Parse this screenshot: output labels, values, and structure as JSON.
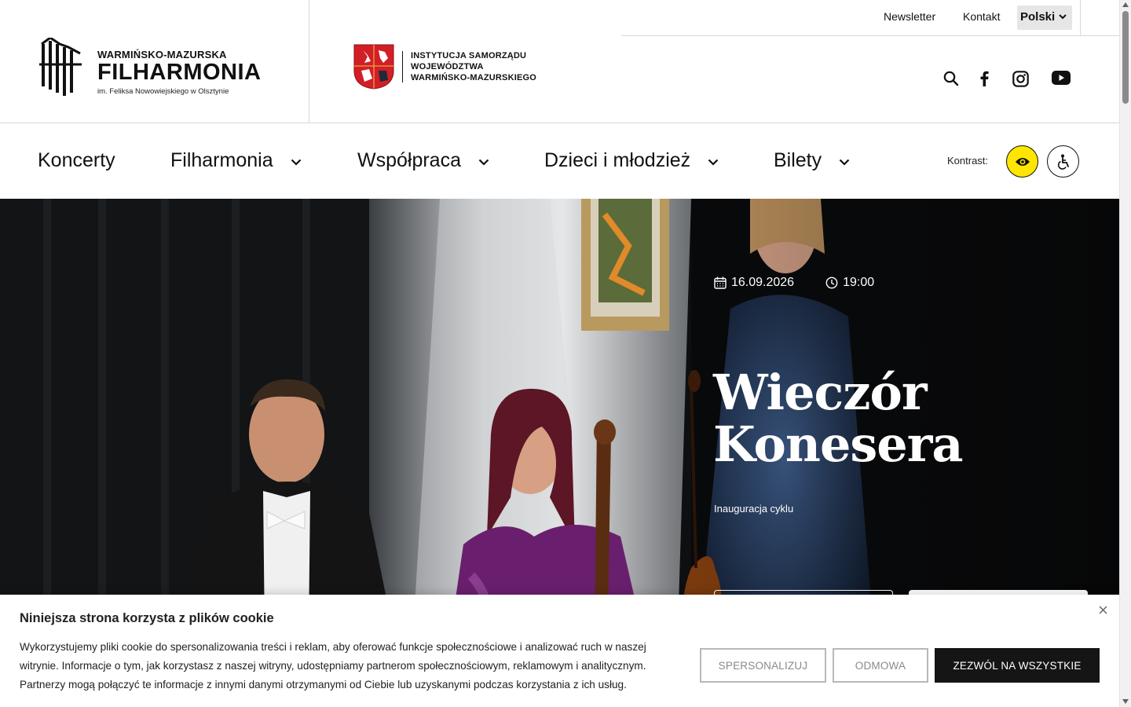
{
  "logo": {
    "line1": "WARMIŃSKO-MAZURSKA",
    "line2": "FILHARMONIA",
    "line3": "im. Feliksa Nowowiejskiego w Olsztynie"
  },
  "institution": {
    "lines": [
      "INSTYTUCJA SAMORZĄDU",
      "WOJEWÓDZTWA",
      "WARMIŃSKO-MAZURSKIEGO"
    ]
  },
  "topbar": {
    "newsletter": "Newsletter",
    "contact": "Kontakt",
    "language": "Polski"
  },
  "social_icons": [
    "search-icon",
    "facebook-icon",
    "instagram-icon",
    "youtube-icon"
  ],
  "nav": {
    "items": [
      {
        "label": "Koncerty",
        "dropdown": false
      },
      {
        "label": "Filharmonia",
        "dropdown": true
      },
      {
        "label": "Współpraca",
        "dropdown": true
      },
      {
        "label": "Dzieci i młodzież",
        "dropdown": true
      },
      {
        "label": "Bilety",
        "dropdown": true
      }
    ],
    "contrast_label": "Kontrast:"
  },
  "hero": {
    "date": "16.09.2026",
    "time": "19:00",
    "title_line1": "Wieczór",
    "title_line2": "Konesera",
    "subtitle": "Inauguracja cyklu"
  },
  "cookie": {
    "title": "Niniejsza strona korzysta z plików cookie",
    "body": "Wykorzystujemy pliki cookie do spersonalizowania treści i reklam, aby oferować funkcje społecznościowe i analizować ruch w naszej witrynie. Informacje o tym, jak korzystasz z naszej witryny, udostępniamy partnerom społecznościowym, reklamowym i analitycznym. Partnerzy mogą połączyć te informacje z innymi danymi otrzymanymi od Ciebie lub uzyskanymi podczas korzystania z ich usług.",
    "personalize": "SPERSONALIZUJ",
    "decline": "ODMOWA",
    "accept": "ZEZWÓL NA WSZYSTKIE"
  },
  "colors": {
    "contrast_accent": "#ffe600",
    "accept_button": "#151515",
    "hero_background": "#0d0e10"
  }
}
